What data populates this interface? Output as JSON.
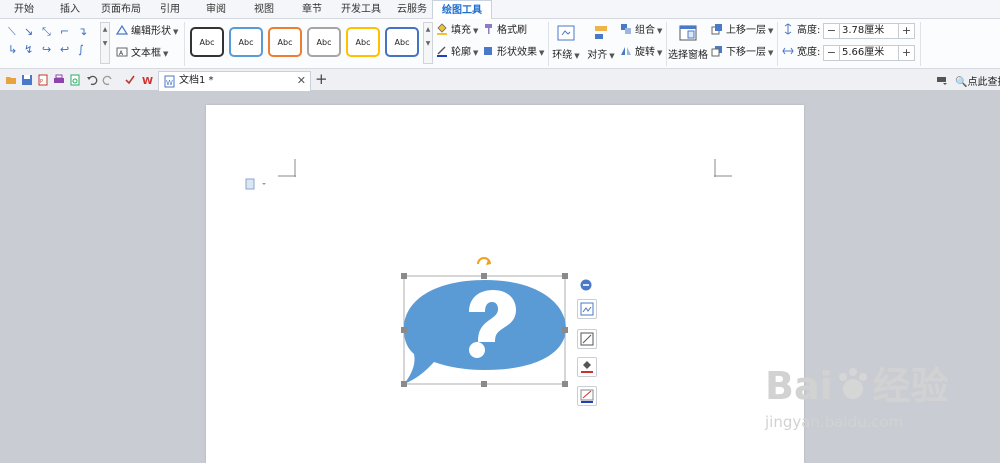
{
  "tabs": [
    {
      "label": "开始"
    },
    {
      "label": "插入"
    },
    {
      "label": "页面布局"
    },
    {
      "label": "引用"
    },
    {
      "label": "审阅"
    },
    {
      "label": "视图"
    },
    {
      "label": "章节"
    },
    {
      "label": "开发工具"
    },
    {
      "label": "云服务"
    },
    {
      "label": "绘图工具"
    }
  ],
  "ribbon": {
    "edit_shape": "编辑形状",
    "text_box": "文本框",
    "style_sample_text": "Abc",
    "style_colors": [
      "#333333",
      "#5b9bd5",
      "#ed7d31",
      "#a5a5a5",
      "#ffc000",
      "#4472c4"
    ],
    "fill": "填充",
    "format_painter": "格式刷",
    "outline": "轮廓",
    "shape_effects": "形状效果",
    "wrap": "环绕",
    "align": "对齐",
    "group": "组合",
    "rotate": "旋转",
    "selection_pane": "选择窗格",
    "bring_forward": "上移一层",
    "send_backward": "下移一层",
    "height_label": "高度:",
    "height_value": "3.78厘米",
    "width_label": "宽度:",
    "width_value": "5.66厘米"
  },
  "doc_tab": {
    "title": "文档1 *"
  },
  "search_label": "点此查找",
  "shape": {
    "glyph": "?",
    "fill_color": "#5b9bd5"
  },
  "accent_color": "#1f6fd0",
  "watermark": {
    "main": "Bai",
    "brand": "经验",
    "sub": "jingyan.baidu.com"
  }
}
